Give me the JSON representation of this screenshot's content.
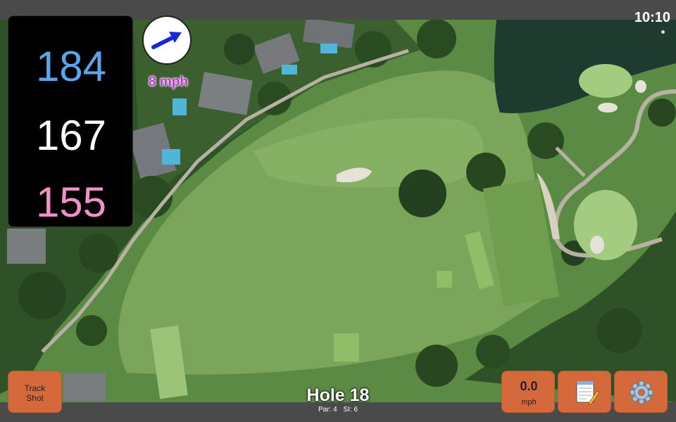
{
  "status": {
    "time": "10:10"
  },
  "distances": {
    "back": "184",
    "middle": "167",
    "front": "155"
  },
  "wind": {
    "speed_label": "8 mph",
    "arrow_icon": "wind-direction-arrow-icon"
  },
  "hole": {
    "title": "Hole 18",
    "par": "Par: 4",
    "si": "SI: 6"
  },
  "buttons": {
    "track_shot": "Track Shot",
    "wind_value": "0.0",
    "wind_unit": "mph",
    "notes_icon": "notepad-icon",
    "settings_icon": "gear-icon"
  },
  "colors": {
    "back": "#5aa6ee",
    "middle": "#ffffff",
    "front": "#f08fc8",
    "wind_text": "#c433d6",
    "button": "#d5693c"
  }
}
